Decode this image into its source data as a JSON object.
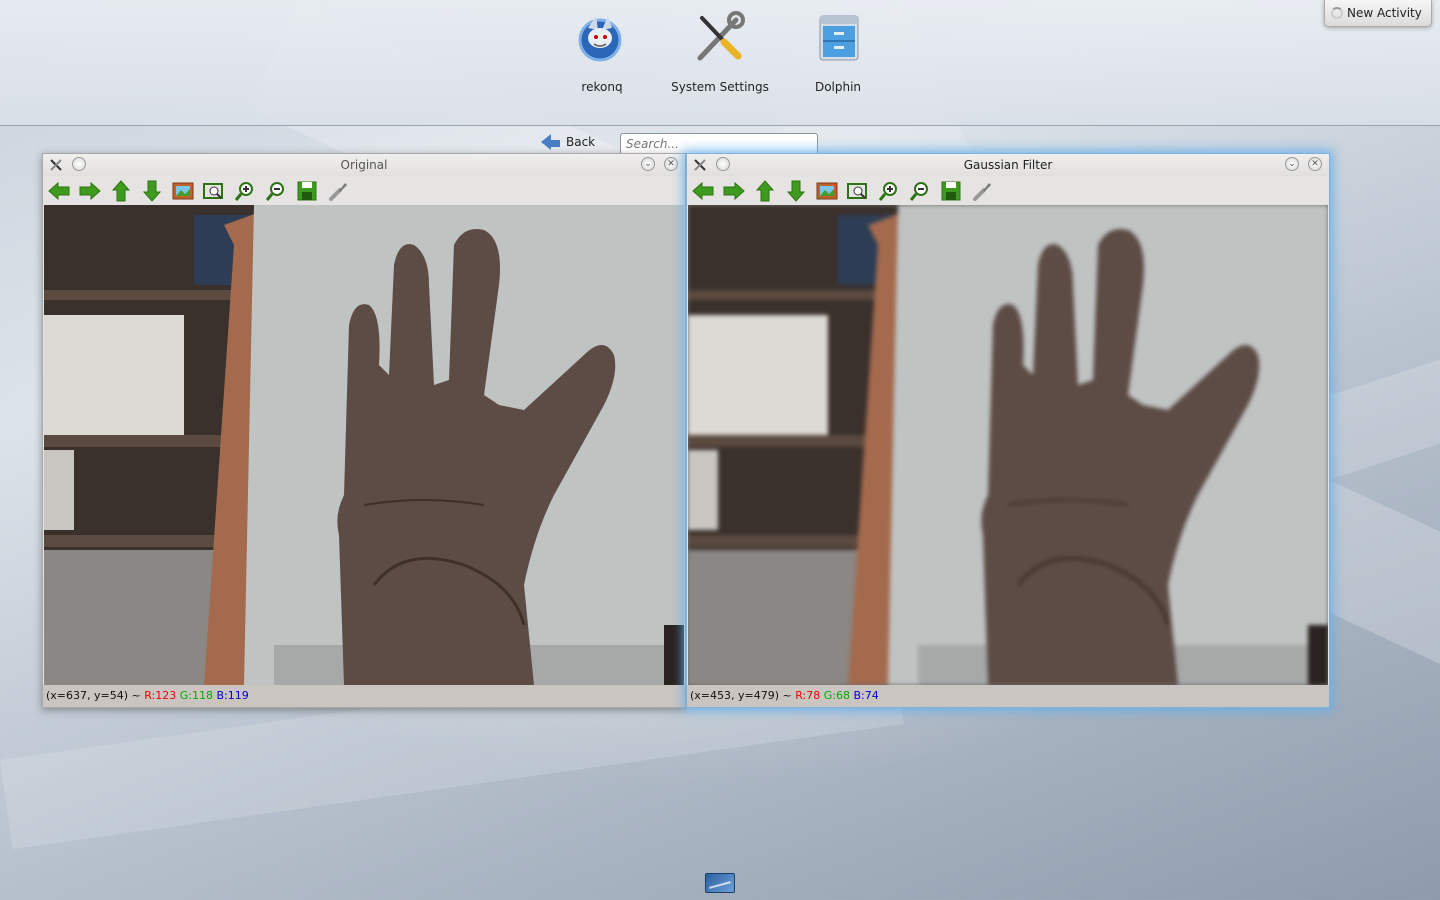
{
  "launcher": {
    "apps": [
      {
        "label": "rekonq",
        "icon": "rekonq-browser-icon"
      },
      {
        "label": "System Settings",
        "icon": "system-settings-icon"
      },
      {
        "label": "Dolphin",
        "icon": "dolphin-file-manager-icon"
      }
    ],
    "new_activity_label": "New Activity",
    "back_label": "Back",
    "search_placeholder": "Search..."
  },
  "windows": [
    {
      "title": "Original",
      "status": {
        "coords": "(x=637, y=54) ~ ",
        "r": "R:123",
        "g": "G:118",
        "b": "B:119"
      },
      "active": false
    },
    {
      "title": "Gaussian Filter",
      "status": {
        "coords": "(x=453, y=479) ~ ",
        "r": "R:78",
        "g": "G:68",
        "b": "B:74"
      },
      "active": true
    }
  ],
  "toolbar_icons": [
    "arrow-left-icon",
    "arrow-right-icon",
    "arrow-up-icon",
    "arrow-down-icon",
    "image-icon",
    "zoom-fit-icon",
    "zoom-in-icon",
    "zoom-out-icon",
    "save-icon",
    "properties-icon"
  ],
  "colors": {
    "accent_active": "#64afeb",
    "toolbar_green": "#3f9b1f"
  }
}
